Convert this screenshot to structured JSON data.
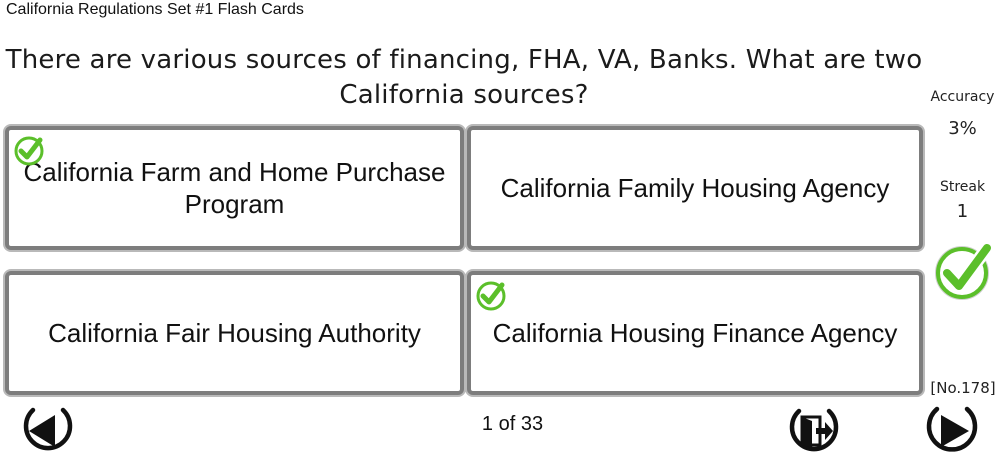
{
  "header": {
    "title": "California Regulations Set #1 Flash Cards"
  },
  "question": {
    "text": "There are various sources of financing, FHA, VA, Banks. What are two California sources?"
  },
  "answers": [
    {
      "label": "California Farm and Home Purchase Program",
      "correct": true
    },
    {
      "label": "California Family Housing Agency",
      "correct": false
    },
    {
      "label": "California Fair Housing Authority",
      "correct": false
    },
    {
      "label": "California Housing Finance Agency",
      "correct": true
    }
  ],
  "stats": {
    "accuracy_label": "Accuracy",
    "accuracy_value": "3%",
    "streak_label": "Streak",
    "streak_value": "1",
    "result_icon": "check-icon"
  },
  "card_number": "[No.178]",
  "navigation": {
    "page_counter": "1 of 33",
    "prev_icon": "previous-arrow-icon",
    "exit_icon": "exit-icon",
    "next_icon": "next-arrow-icon"
  },
  "colors": {
    "check_green": "#5bbf2a",
    "answer_border": "#7d7d7d",
    "text": "#111111"
  }
}
